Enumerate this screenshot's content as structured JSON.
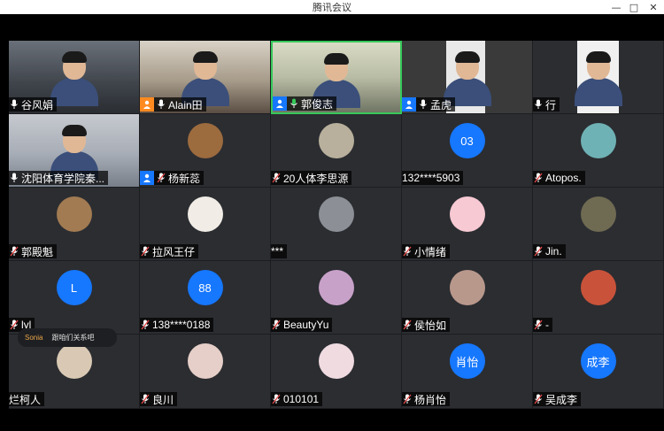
{
  "window": {
    "title": "腾讯会议",
    "minimize": "—",
    "maximize": "□",
    "close": "✕"
  },
  "chat": {
    "sender": "Sonia",
    "message": "跟咱们关系吧"
  },
  "tiles": [
    {
      "name": "谷风娟",
      "kind": "video",
      "style": "video1",
      "mic": "on"
    },
    {
      "name": "Alain田",
      "kind": "video",
      "style": "video2",
      "mic": "on",
      "host": "orange"
    },
    {
      "name": "郭俊志",
      "kind": "video",
      "style": "video3",
      "mic": "active",
      "host": "blue",
      "active": true
    },
    {
      "name": "孟虎",
      "kind": "video",
      "style": "video4",
      "mic": "on",
      "host": "blue"
    },
    {
      "name": "行",
      "kind": "video",
      "style": "video5",
      "mic": "on"
    },
    {
      "name": "沈阳体育学院秦...",
      "kind": "video",
      "style": "video6",
      "mic": "on"
    },
    {
      "name": "杨新蕊",
      "kind": "avatar",
      "avatar_color": "#9c6b3e",
      "mic": "muted",
      "host": "blue"
    },
    {
      "name": "20人体李思源",
      "kind": "avatar",
      "avatar_color": "#b8b09c",
      "mic": "muted"
    },
    {
      "name": "132****5903",
      "kind": "text",
      "avatar_text": "03",
      "mic": "none"
    },
    {
      "name": "Atopos.",
      "kind": "avatar",
      "avatar_color": "#6fb2b5",
      "mic": "muted"
    },
    {
      "name": "郭殿魁",
      "kind": "avatar",
      "avatar_color": "#a27b52",
      "mic": "muted"
    },
    {
      "name": "拉风王仔",
      "kind": "avatar",
      "avatar_color": "#f1ede6",
      "mic": "muted"
    },
    {
      "name": "***",
      "kind": "avatar",
      "avatar_color": "#8c8f96",
      "mic": "none"
    },
    {
      "name": "小情绪",
      "kind": "avatar",
      "avatar_color": "#f7c9d3",
      "mic": "muted"
    },
    {
      "name": "Jin.",
      "kind": "avatar",
      "avatar_color": "#6f6a52",
      "mic": "muted"
    },
    {
      "name": "lyl",
      "kind": "text",
      "avatar_text": "L",
      "mic": "muted"
    },
    {
      "name": "138****0188",
      "kind": "text",
      "avatar_text": "88",
      "mic": "muted"
    },
    {
      "name": "BeautyYu",
      "kind": "avatar",
      "avatar_color": "#c8a1c9",
      "mic": "muted"
    },
    {
      "name": "侯怡如",
      "kind": "avatar",
      "avatar_color": "#b9988c",
      "mic": "muted"
    },
    {
      "name": "-",
      "kind": "avatar",
      "avatar_color": "#c9533a",
      "mic": "muted"
    },
    {
      "name": "烂柯人",
      "kind": "avatar",
      "avatar_color": "#d9c9b4",
      "mic": "none"
    },
    {
      "name": "良川",
      "kind": "avatar",
      "avatar_color": "#e6cfc8",
      "mic": "muted"
    },
    {
      "name": "010101",
      "kind": "avatar",
      "avatar_color": "#f0dbe1",
      "mic": "muted"
    },
    {
      "name": "杨肖怡",
      "kind": "text",
      "avatar_text": "肖怡",
      "mic": "muted"
    },
    {
      "name": "吴成李",
      "kind": "text",
      "avatar_text": "成李",
      "mic": "muted"
    }
  ]
}
